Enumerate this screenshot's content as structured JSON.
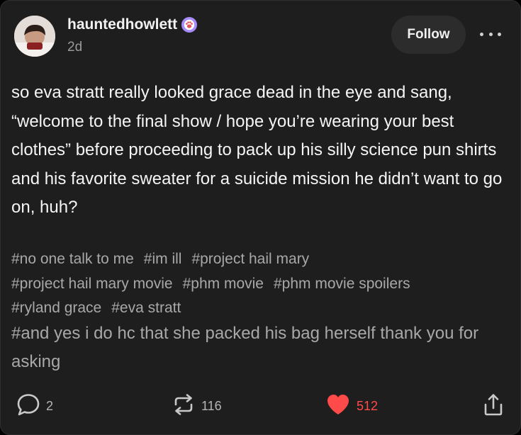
{
  "post": {
    "username": "hauntedhowlett",
    "timestamp": "2d",
    "follow_label": "Follow",
    "body": "so eva stratt really looked grace dead in the eye and sang, “welcome to the final show / hope you’re wearing your best clothes” before proceeding to pack up his silly science pun shirts and his favorite sweater for a suicide mission he didn’t want to go on, huh?",
    "tags_small": [
      "#no one talk to me",
      "#im ill",
      "#project hail mary",
      "#project hail mary movie",
      "#phm movie",
      "#phm movie spoilers",
      "#ryland grace",
      "#eva stratt"
    ],
    "tag_large": "#and yes i do hc that she packed his bag herself thank you for asking"
  },
  "actions": {
    "comments": "2",
    "reblogs": "116",
    "likes": "512"
  },
  "colors": {
    "background": "#1e1e1e",
    "like": "#ff4a4a",
    "badge": "#a78bfa"
  },
  "icons": [
    "paw-badge-icon",
    "more-icon",
    "comment-icon",
    "reblog-icon",
    "heart-icon",
    "share-icon"
  ]
}
